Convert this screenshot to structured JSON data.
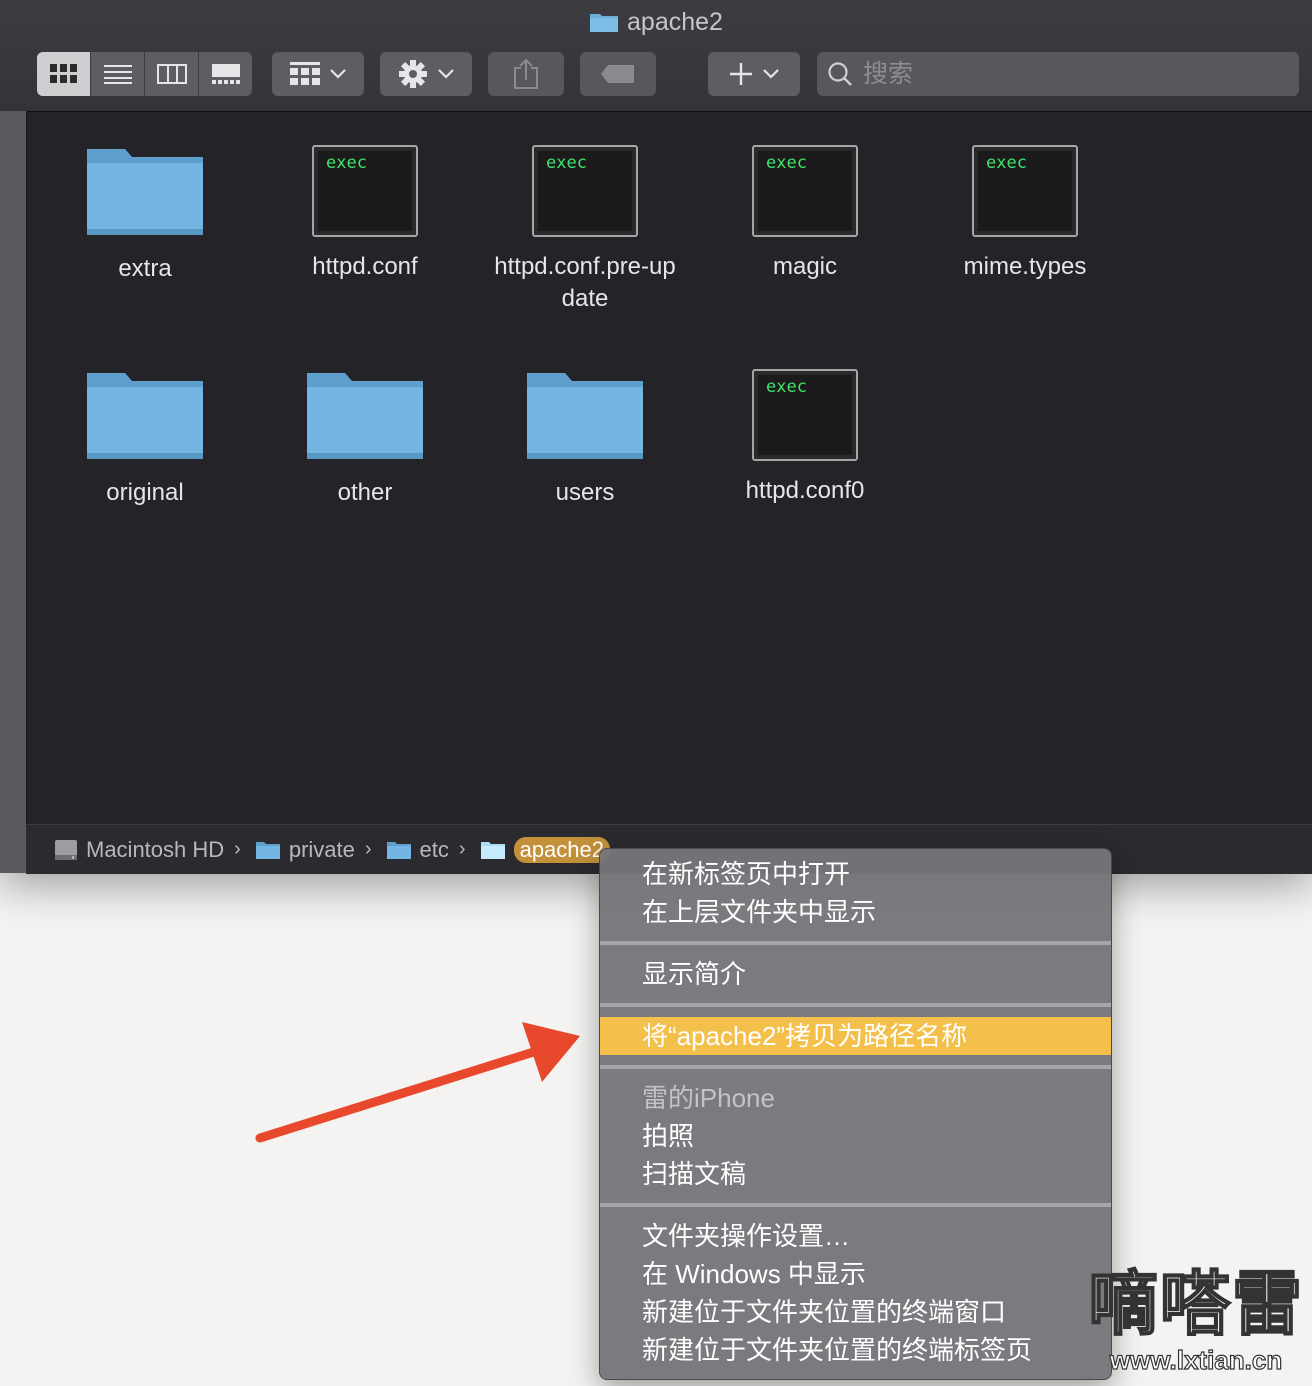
{
  "window": {
    "title": "apache2"
  },
  "toolbar": {
    "view_buttons": [
      "icon-view",
      "list-view",
      "column-view",
      "gallery-view"
    ],
    "search_placeholder": "搜索"
  },
  "files": [
    {
      "name": "extra",
      "type": "folder"
    },
    {
      "name": "httpd.conf",
      "type": "exec"
    },
    {
      "name": "httpd.conf.pre-update",
      "type": "exec"
    },
    {
      "name": "magic",
      "type": "exec"
    },
    {
      "name": "mime.types",
      "type": "exec"
    },
    {
      "name": "original",
      "type": "folder"
    },
    {
      "name": "other",
      "type": "folder"
    },
    {
      "name": "users",
      "type": "folder"
    },
    {
      "name": "httpd.conf0",
      "type": "exec"
    }
  ],
  "exec_label": "exec",
  "pathbar": [
    "Macintosh HD",
    "private",
    "etc",
    "apache2"
  ],
  "context_menu": {
    "group1": [
      "在新标签页中打开",
      "在上层文件夹中显示"
    ],
    "group2": [
      "显示简介"
    ],
    "group3": [
      "将“apache2”拷贝为路径名称"
    ],
    "group4_header": "雷的iPhone",
    "group4": [
      "拍照",
      "扫描文稿"
    ],
    "group5": [
      "文件夹操作设置…",
      "在 Windows 中显示",
      "新建位于文件夹位置的终端窗口",
      "新建位于文件夹位置的终端标签页"
    ]
  },
  "watermark": {
    "big": "嘀嗒雷",
    "small": "www.lxtian.cn"
  },
  "colors": {
    "highlight": "#f3c04c",
    "arrow": "#e8482b",
    "folder": "#6fb3e0",
    "path_selected": "#c3913a"
  }
}
